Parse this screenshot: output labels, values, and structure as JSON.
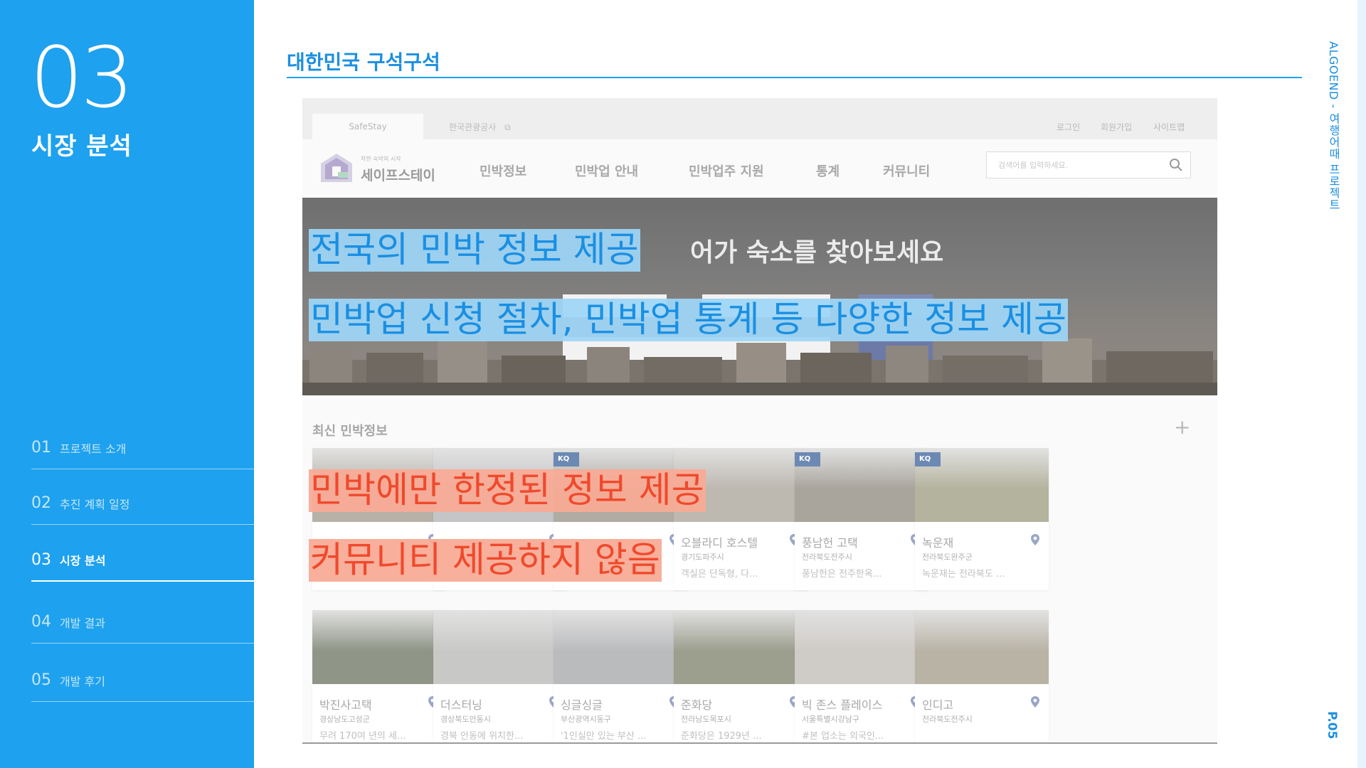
{
  "section": {
    "number": "03",
    "title": "시장 분석"
  },
  "nav": [
    {
      "num": "01",
      "label": "프로젝트 소개"
    },
    {
      "num": "02",
      "label": "추진 계획 일정"
    },
    {
      "num": "03",
      "label": "시장 분석"
    },
    {
      "num": "04",
      "label": "개발 결과"
    },
    {
      "num": "05",
      "label": "개발 후기"
    }
  ],
  "heading": "대한민국 구석구석",
  "side_label": "ALGOEND - 여행어때 프로젝트",
  "page_number": "P.05",
  "site": {
    "tab_active": "SafeStay",
    "tab_other": "한국관광공사",
    "util_links": [
      "로그인",
      "회원가입",
      "사이트맵"
    ],
    "logo_tagline": "착한 숙박의 시작",
    "logo_name": "세이프스테이",
    "menu": [
      "민박정보",
      "민박업 안내",
      "민박업주 지원",
      "통계",
      "커뮤니티"
    ],
    "search_placeholder": "검색어를 입력하세요.",
    "hero_title": "어가 숙소를 찾아보세요",
    "recent_title": "최신 민박정보",
    "plus": "+",
    "cards": [
      {
        "name": "",
        "loc": "",
        "desc": "",
        "kq": false,
        "color": "#b7b2a8"
      },
      {
        "name": "",
        "loc": "",
        "desc": "",
        "kq": false,
        "color": "#c5c5c8"
      },
      {
        "name": "",
        "loc": "",
        "desc": "",
        "kq": true,
        "color": "#b0aca4"
      },
      {
        "name": "오블라디 호스텔",
        "loc": "경기도파주시",
        "desc": "객실은 단독형, 다...",
        "kq": false,
        "color": "#bdb8b0"
      },
      {
        "name": "풍남헌 고택",
        "loc": "전라북도전주시",
        "desc": "풍남헌은 전주한옥...",
        "kq": true,
        "color": "#a9a59c"
      },
      {
        "name": "녹운재",
        "loc": "전라북도완주군",
        "desc": "녹운재는 전라북도 ...",
        "kq": true,
        "color": "#b4b39e"
      },
      {
        "name": "박진사고택",
        "loc": "경상남도고성군",
        "desc": "무려 170여 년의 세...",
        "kq": false,
        "color": "#8f9587"
      },
      {
        "name": "더스터닝",
        "loc": "경상북도안동시",
        "desc": "경북 안동에 위치한...",
        "kq": false,
        "color": "#c8c9c6"
      },
      {
        "name": "싱글싱글",
        "loc": "부산광역시동구",
        "desc": "'1인실만 있는 부산 ...",
        "kq": false,
        "color": "#babbbd"
      },
      {
        "name": "준화당",
        "loc": "전라남도목포시",
        "desc": "준화당은 1929년 ...",
        "kq": false,
        "color": "#9c9e8e"
      },
      {
        "name": "빅 존스 플레이스",
        "loc": "서울특별시강남구",
        "desc": "#본 업소는 외국인...",
        "kq": false,
        "color": "#cfcbc6"
      },
      {
        "name": "인디고",
        "loc": "전라북도전주시",
        "desc": "",
        "kq": false,
        "color": "#b9b3a6"
      }
    ]
  },
  "annotations": {
    "blue1": "전국의 민박 정보 제공",
    "blue2": "민박업 신청 절차, 민박업 통계 등 다양한 정보 제공",
    "red1": "민박에만 한정된 정보 제공",
    "red2": "커뮤니티 제공하지 않음"
  },
  "colors": {
    "brand_blue": "#1ea1ee",
    "highlight_blue": "#9ed6f6",
    "highlight_red": "#f8ab96",
    "annotation_red": "#f0492c"
  }
}
